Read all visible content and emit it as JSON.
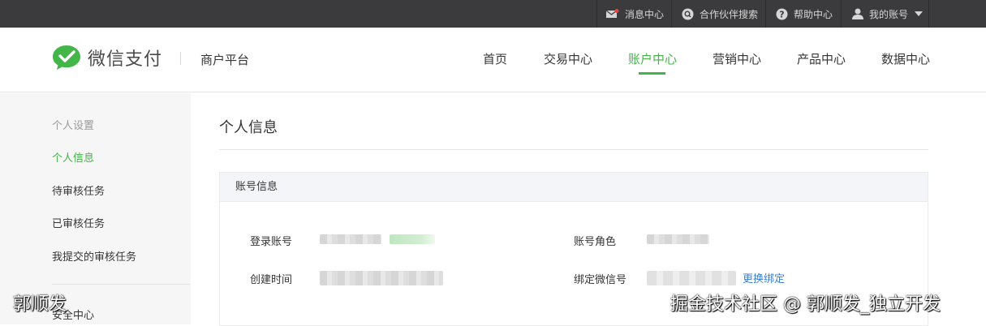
{
  "topbar": {
    "messages_label": "消息中心",
    "partner_search_label": "合作伙伴搜索",
    "help_label": "帮助中心",
    "account_label": "我的账号"
  },
  "header": {
    "brand": "微信支付",
    "platform": "商户平台",
    "nav": [
      "首页",
      "交易中心",
      "账户中心",
      "营销中心",
      "产品中心",
      "数据中心"
    ],
    "active_nav": "账户中心"
  },
  "sidebar": {
    "heading": "个人设置",
    "items": [
      "个人信息",
      "待审核任务",
      "已审核任务",
      "我提交的审核任务"
    ],
    "security": "安全中心"
  },
  "main": {
    "title": "个人信息",
    "panel_title": "账号信息",
    "fields": {
      "login_account": "登录账号",
      "account_role": "账号角色",
      "created_time": "创建时间",
      "bound_wechat": "绑定微信号"
    },
    "rebind_link": "更换绑定"
  },
  "watermarks": {
    "left": "郭顺发",
    "right": "掘金技术社区 @ 郭顺发_独立开发"
  },
  "colors": {
    "accent": "#44b549",
    "topbar": "#3b3b3d",
    "link": "#3a7fd5"
  }
}
